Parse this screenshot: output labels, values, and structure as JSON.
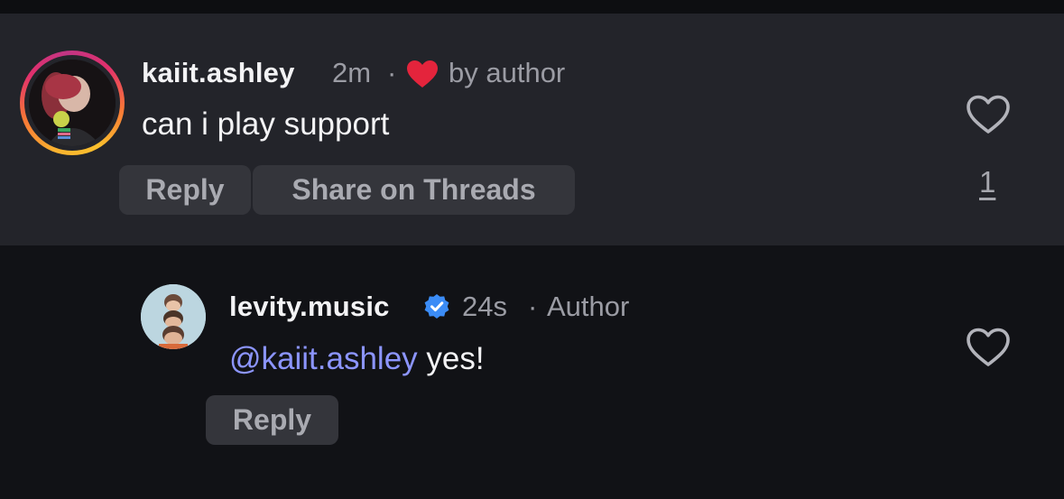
{
  "comment": {
    "username": "kaiit.ashley",
    "time": "2m",
    "separator": "·",
    "liked_by_author": "by author",
    "text": "can i play support",
    "reply_label": "Reply",
    "share_label": "Share on Threads",
    "like_count": "1",
    "heart_color": "#e4243c"
  },
  "reply": {
    "username": "levity.music",
    "time": "24s",
    "separator": "·",
    "role": "Author",
    "mention": "@kaiit.ashley",
    "text": " yes!",
    "reply_label": "Reply",
    "verified_color": "#3b8cf6"
  },
  "icons": {
    "comment_like": "heart-outline-icon",
    "reply_like": "heart-outline-icon",
    "author_like": "heart-filled-icon",
    "verified": "verified-badge-icon"
  }
}
